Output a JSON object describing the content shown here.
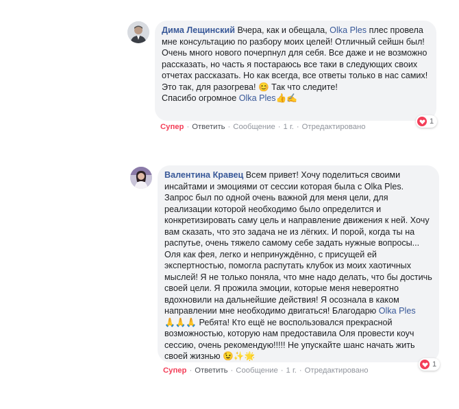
{
  "comments": [
    {
      "author": "Дима Лещинский",
      "text_1": " Вчера, как и обещала, ",
      "mention_1": "Olka Ples",
      "text_2": " плес провела мне консультацию по разбору моих целей! Отличный сейшн был!",
      "para_2": "Очень много нового почерпнул для себя. Все даже и не возможно рассказать, но часть я постараюсь все таки в следующих своих отчетах рассказать. Но как всегда, все ответы только в нас самих! Это так, для разогрева! ",
      "para_2_emoji": "😊",
      "para_2_tail": " Так что следите!",
      "para_3": "Спасибо огромное ",
      "mention_2": "Olka Ples",
      "emoji_end": " 👍✍",
      "actions": {
        "like": "Супер",
        "reply": "Ответить",
        "message": "Сообщение",
        "time": "1 г.",
        "edited": "Отредактировано"
      },
      "reaction_count": "1"
    },
    {
      "author": "Валентина Кравец",
      "text_1": " Всем привет! Хочу поделиться своими инсайтами и эмоциями от сессии которая была с Olka Ples. Запрос был по одной очень важной для меня цели, для реализации которой необходимо было определится и конкретизировать саму цель и направление движения к ней. Хочу вам сказать, что это задача не из лёгких. И порой, когда ты на распутье, очень тяжело самому себе задать нужные вопросы... Оля как фея, легко и непринуждённо, с присущей ей экспертностью, помогла распутать клубок из моих хаотичных мыслей! Я не только поняла, что мне надо делать, что бы достичь своей цели. Я прожила эмоции, которые меня невероятно вдохновили на дальнейшие действия! Я осознала в каком направлении мне необходимо двигаться! Благодарю ",
      "mention_1": "Olka Ples",
      "emoji_mid": "🙏🙏🙏",
      "text_2": " Ребята! Кто ещё не воспользовался прекрасной возможностью, которую нам предоставила Оля провести коуч сессию, очень рекомендую!!!!! Не упускайте шанс начать жить своей жизнью ",
      "emoji_end": "😉✨🌟",
      "actions": {
        "like": "Супер",
        "reply": "Ответить",
        "message": "Сообщение",
        "time": "1 г.",
        "edited": "Отредактировано"
      },
      "reaction_count": "1"
    }
  ],
  "colors": {
    "bubble": "#f2f3f5",
    "link": "#385898",
    "love": "#f33e58",
    "meta": "#90949c"
  },
  "icons": [
    "avatar-dima",
    "avatar-valentina",
    "heart-icon"
  ]
}
